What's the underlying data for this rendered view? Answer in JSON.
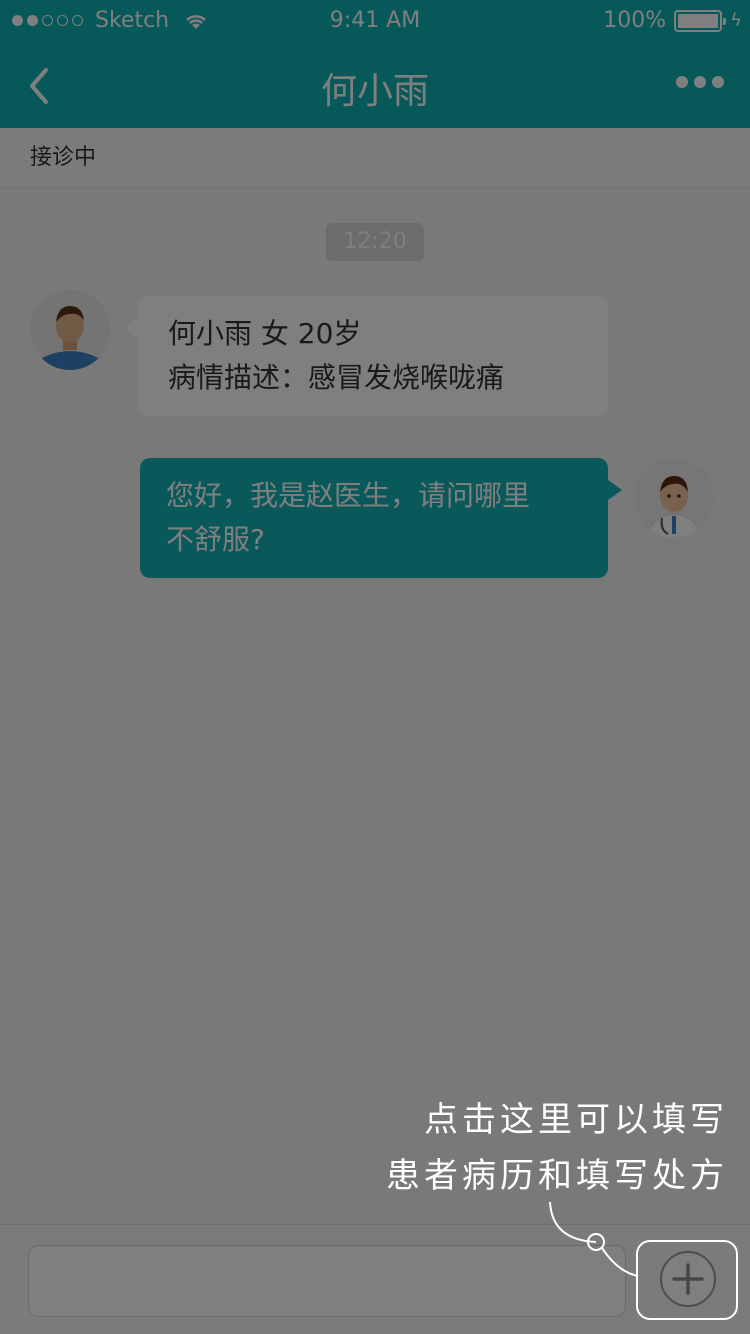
{
  "status_bar": {
    "carrier": "Sketch",
    "time": "9:41 AM",
    "battery": "100%"
  },
  "nav": {
    "title": "何小雨"
  },
  "subbar": {
    "status": "接诊中"
  },
  "chat": {
    "time_divider": "12:20",
    "messages": [
      {
        "sender": "patient",
        "lines": [
          "何小雨   女   20岁",
          "病情描述：感冒发烧喉咙痛"
        ]
      },
      {
        "sender": "doctor",
        "lines": [
          "您好，我是赵医生，请问哪里",
          "不舒服?"
        ]
      }
    ]
  },
  "hint": {
    "line1": "点击这里可以填写",
    "line2": "患者病历和填写处方"
  },
  "colors": {
    "brand_teal": "#0fb0b2",
    "overlay": "rgba(0,0,0,0.5)"
  }
}
